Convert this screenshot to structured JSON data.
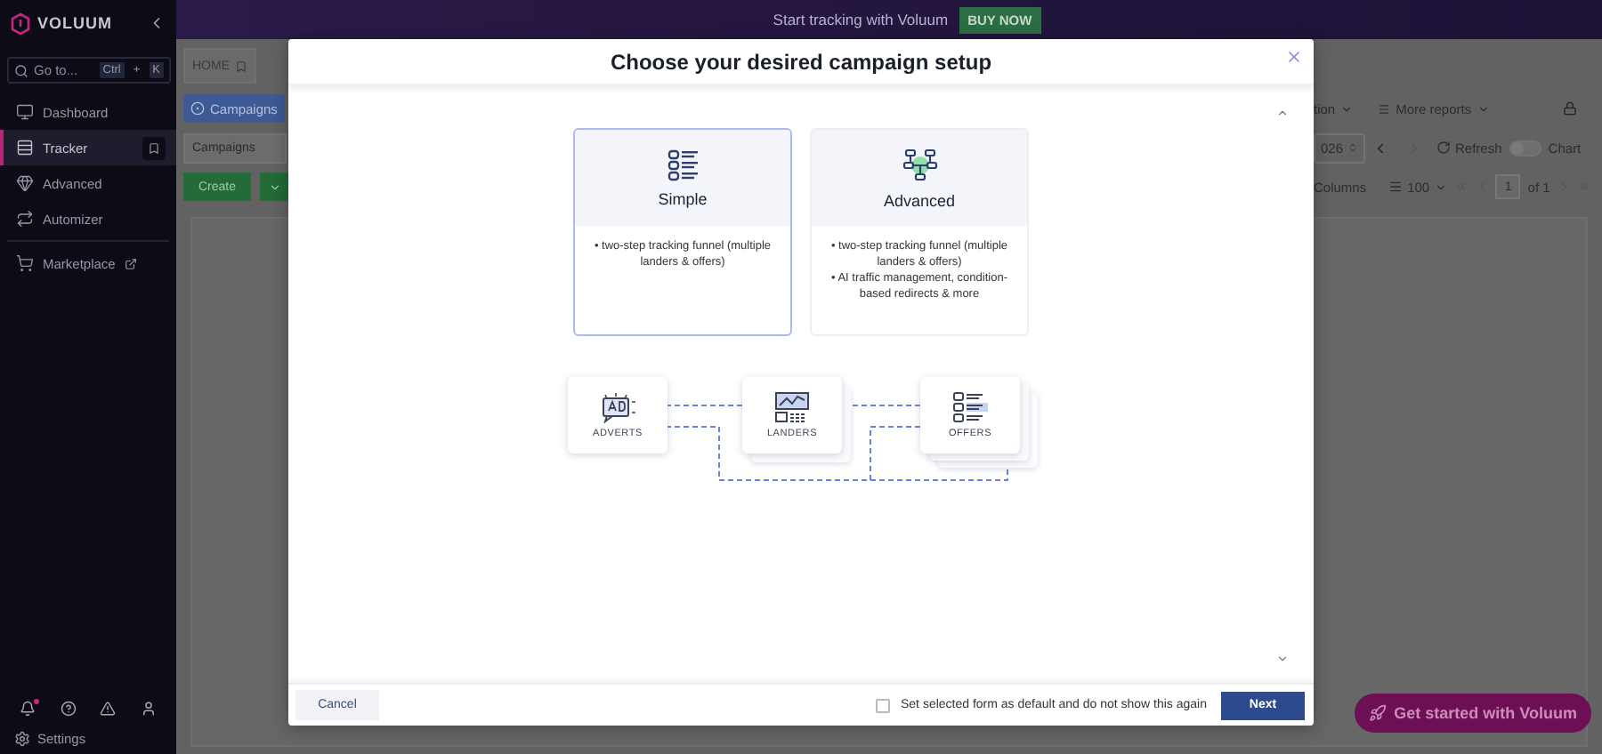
{
  "sidebar": {
    "brand": "VOLUUM",
    "search": {
      "placeholder": "Go to...",
      "keys": [
        "Ctrl",
        "+",
        "K"
      ]
    },
    "items": [
      {
        "label": "Dashboard",
        "kind": "dashboard",
        "selected": false
      },
      {
        "label": "Tracker",
        "kind": "tracker",
        "selected": true
      },
      {
        "label": "Advanced",
        "kind": "advanced",
        "selected": false
      },
      {
        "label": "Automizer",
        "kind": "automizer",
        "selected": false
      },
      {
        "label": "Marketplace",
        "kind": "marketplace",
        "selected": false
      }
    ],
    "unread_notifications": true,
    "settings": "Settings"
  },
  "banner": {
    "text": "Start tracking with Voluum",
    "button": "BUY NOW"
  },
  "home_tab": "HOME",
  "toolbar": {
    "campaigns_button": "Campaigns",
    "view_select": "Campaigns",
    "create_button": "Create",
    "grouping_partial": "tion",
    "more_reports": "More reports",
    "date_partial": "026",
    "refresh": "Refresh",
    "chart": {
      "label": "Chart",
      "on": false
    },
    "columns": "Columns",
    "page_size": "100",
    "page": "1",
    "page_count": "of 1"
  },
  "modal": {
    "title": "Choose your desired campaign setup",
    "options": [
      {
        "kind": "simple",
        "title": "Simple",
        "selected": true,
        "bullets": [
          "• two-step tracking funnel (multiple landers & offers)"
        ]
      },
      {
        "kind": "advanced",
        "title": "Advanced",
        "selected": false,
        "bullets": [
          "• two-step tracking funnel (multiple landers & offers)",
          "• AI traffic management, condition-based redirects & more"
        ]
      }
    ],
    "diagram": [
      {
        "kind": "adverts",
        "label": "ADVERTS"
      },
      {
        "kind": "landers",
        "label": "LANDERS"
      },
      {
        "kind": "offers",
        "label": "OFFERS"
      }
    ],
    "cancel": "Cancel",
    "default_option": {
      "label": "Set selected form as default and do not show this again",
      "checked": false
    },
    "next": "Next"
  },
  "get_started": "Get started with Voluum"
}
